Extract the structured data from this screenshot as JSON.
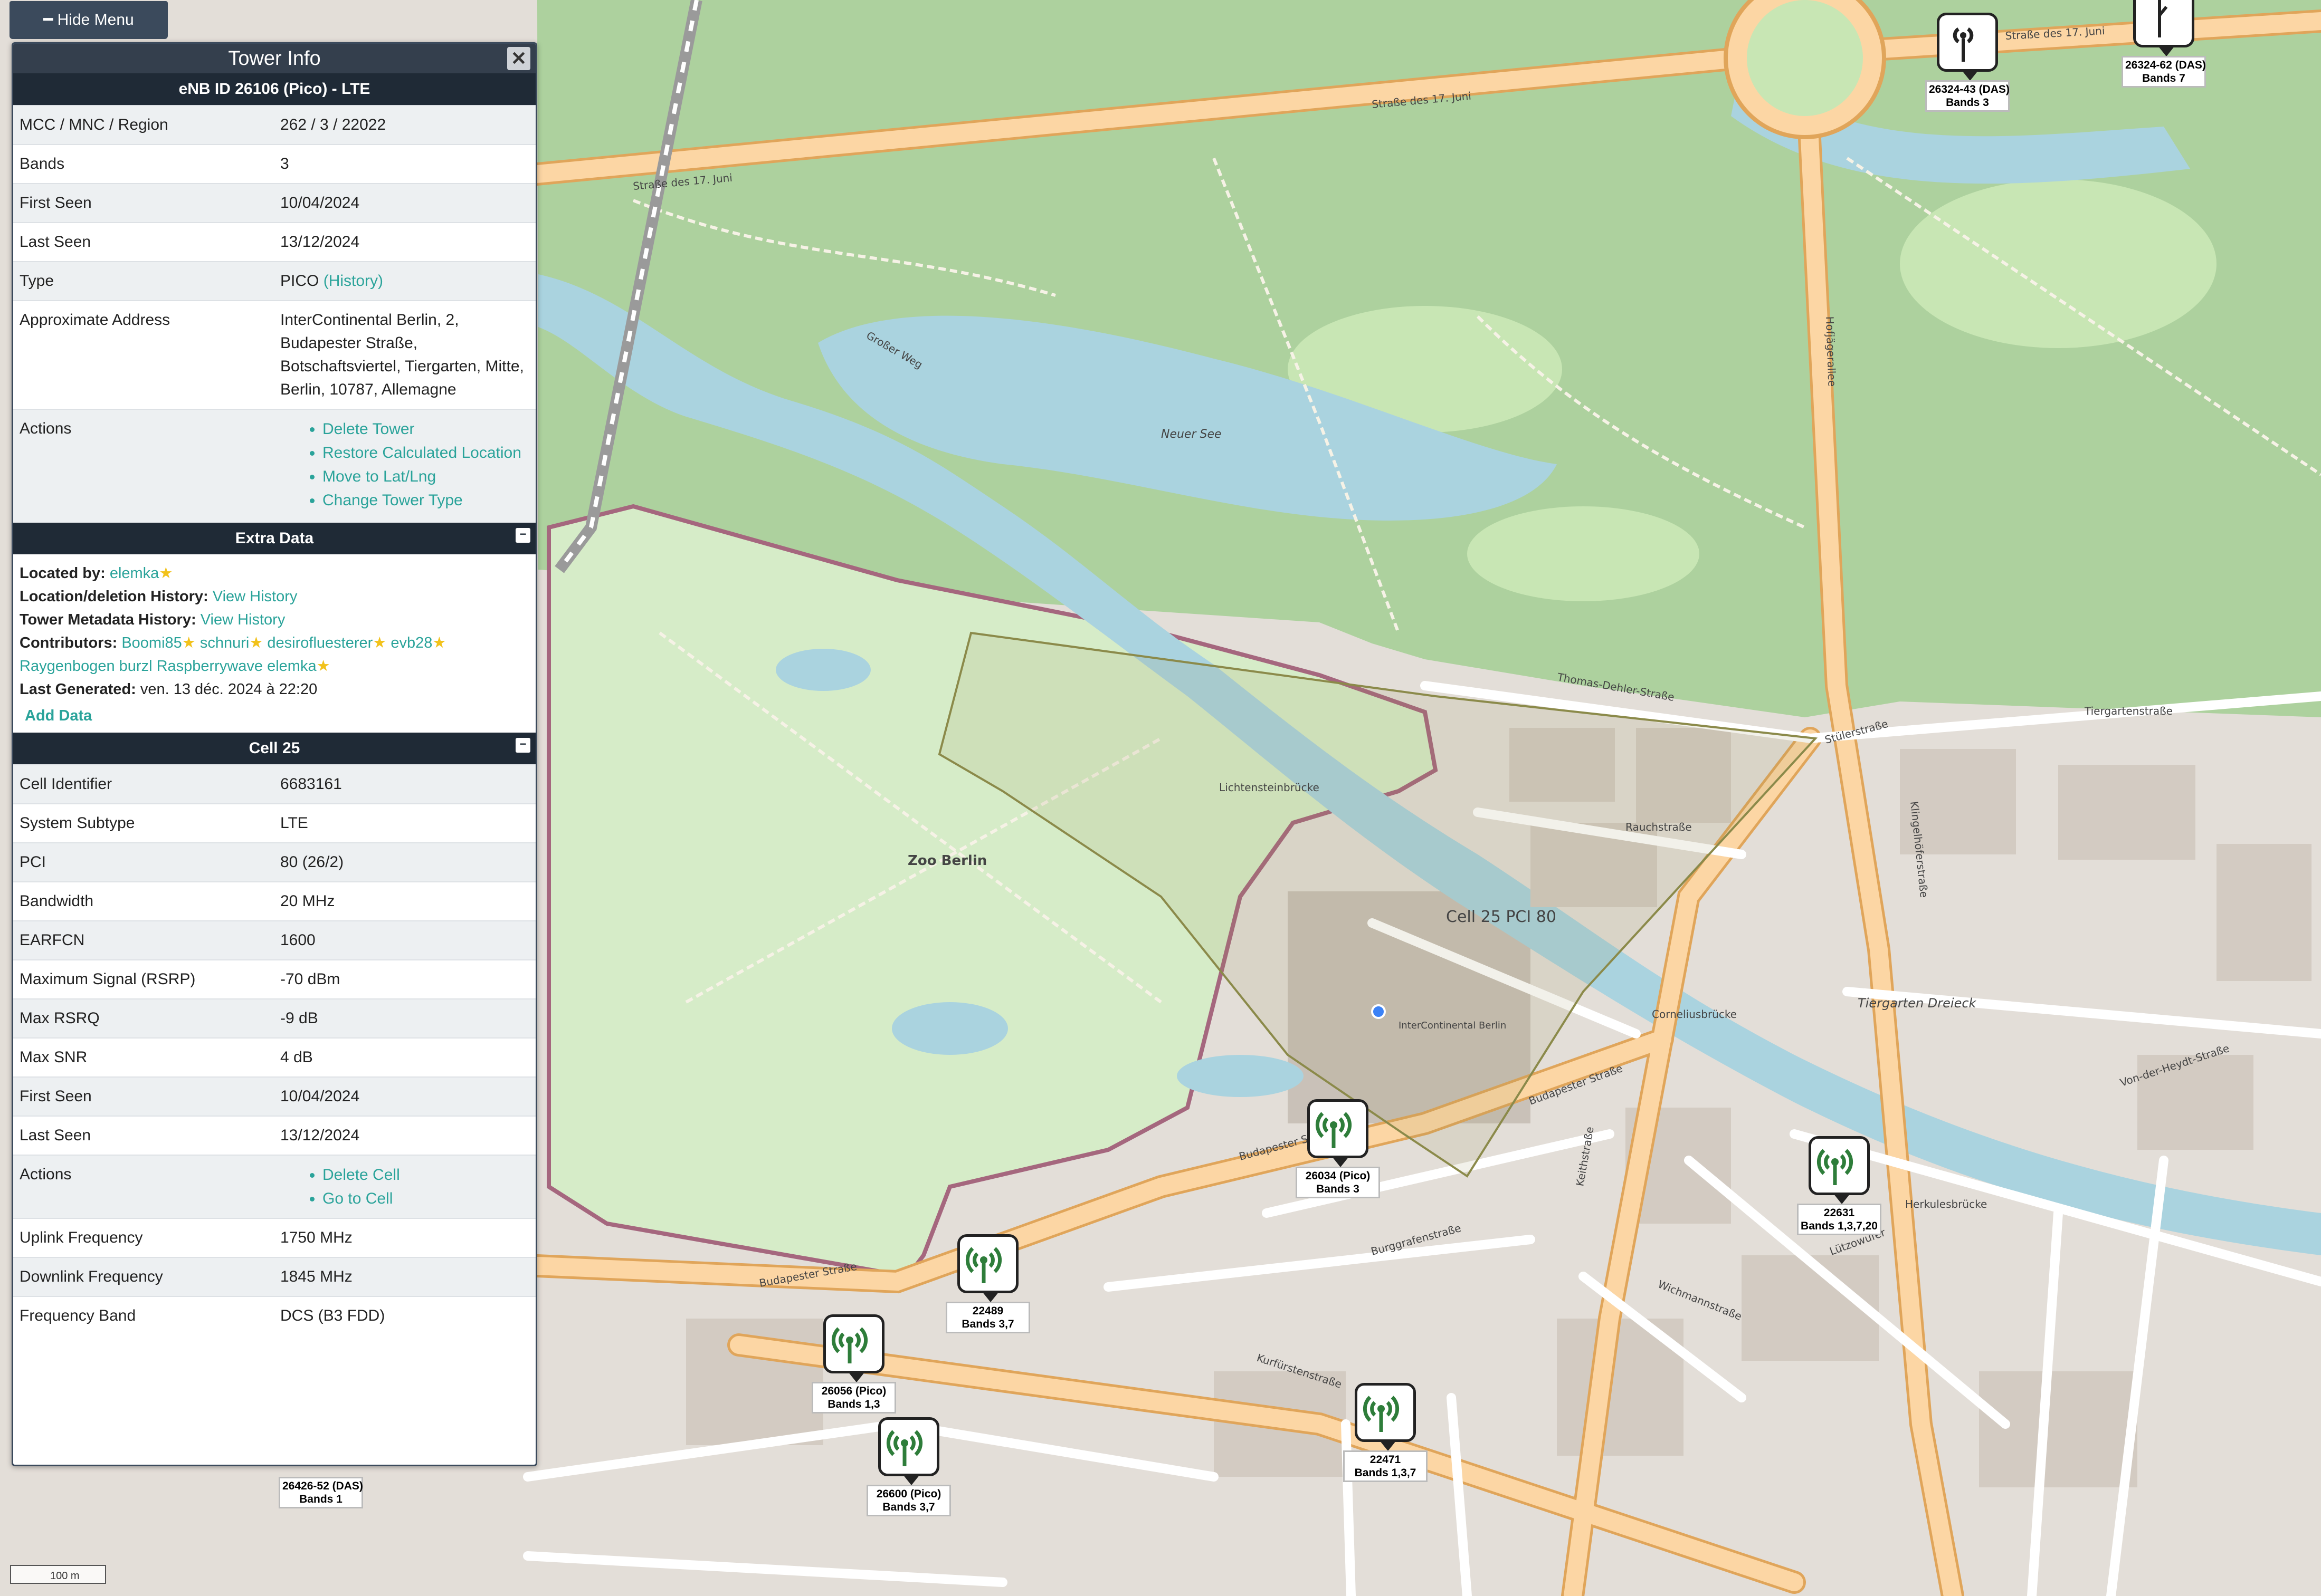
{
  "menu": {
    "hide_label": "━ Hide Menu"
  },
  "tower_info": {
    "title": "Tower Info",
    "close_label": "✕",
    "header": "eNB ID 26106 (Pico) - LTE",
    "rows": [
      {
        "key": "MCC / MNC / Region",
        "value": "262 / 3 / 22022"
      },
      {
        "key": "Bands",
        "value": "3"
      },
      {
        "key": "First Seen",
        "value": "10/04/2024"
      },
      {
        "key": "Last Seen",
        "value": "13/12/2024"
      },
      {
        "key": "Type",
        "value": "PICO",
        "link": "(History)"
      },
      {
        "key": "Approximate Address",
        "value": "InterContinental Berlin, 2, Budapester Straße, Botschaftsviertel, Tiergarten, Mitte, Berlin, 10787, Allemagne"
      }
    ],
    "actions_label": "Actions",
    "actions": [
      "Delete Tower",
      "Restore Calculated Location",
      "Move to Lat/Lng",
      "Change Tower Type"
    ]
  },
  "extra_data": {
    "title": "Extra Data",
    "collapse_label": "−",
    "located_by_label": "Located by:",
    "located_by": "elemka",
    "location_history_label": "Location/deletion History:",
    "location_history_link": "View History",
    "metadata_history_label": "Tower Metadata History:",
    "metadata_history_link": "View History",
    "contributors_label": "Contributors:",
    "contributors": [
      "Boomi85",
      "schnuri",
      "desirofluesterer",
      "evb28",
      "Raygenbogen burzl Raspberrywave elemka"
    ],
    "last_generated_label": "Last Generated:",
    "last_generated": "ven. 13 déc. 2024 à 22:20",
    "add_data": "Add Data"
  },
  "cell": {
    "title": "Cell 25",
    "collapse_label": "−",
    "rows": [
      {
        "key": "Cell Identifier",
        "value": "6683161"
      },
      {
        "key": "System Subtype",
        "value": "LTE"
      },
      {
        "key": "PCI",
        "value": "80 (26/2)"
      },
      {
        "key": "Bandwidth",
        "value": "20 MHz"
      },
      {
        "key": "EARFCN",
        "value": "1600"
      },
      {
        "key": "Maximum Signal (RSRP)",
        "value": "-70 dBm"
      },
      {
        "key": "Max RSRQ",
        "value": "-9 dB"
      },
      {
        "key": "Max SNR",
        "value": "4 dB"
      },
      {
        "key": "First Seen",
        "value": "10/04/2024"
      },
      {
        "key": "Last Seen",
        "value": "13/12/2024"
      }
    ],
    "actions_label": "Actions",
    "actions": [
      "Delete Cell",
      "Go to Cell"
    ],
    "rows2": [
      {
        "key": "Uplink Frequency",
        "value": "1750 MHz"
      },
      {
        "key": "Downlink Frequency",
        "value": "1845 MHz"
      },
      {
        "key": "Frequency Band",
        "value": "DCS (B3 FDD)"
      }
    ]
  },
  "map": {
    "sector_label": "Cell 25 PCI 80",
    "scale": "100 m",
    "labels": {
      "zoo": "Zoo Berlin",
      "neuer_see": "Neuer See",
      "strasse17": "Straße des 17. Juni",
      "budapester": "Budapester Straße",
      "kurfuersten": "Kurfürstenstraße",
      "tiergarten": "Tiergartenstraße",
      "stueler": "Stülerstraße",
      "rauch": "Rauchstraße",
      "corneliusbruecke": "Corneliusbrücke",
      "lichtenstein": "Lichtensteinbrücke",
      "lutzow": "Lützowufer",
      "hofjaeger": "Hofjägerallee",
      "klingel": "Klingelhöferstraße",
      "intercont": "InterContinental Berlin",
      "tiergarten_dreieck": "Tiergarten Dreieck",
      "grosser_weg": "Großer Weg",
      "thomas_dehler": "Thomas-Dehler-Straße",
      "von_der_heydt": "Von-der-Heydt-Straße",
      "herkules": "Herkulesbrücke",
      "keith": "Keithstraße",
      "wichmann": "Wichmannstraße",
      "burggrafen": "Burggrafenstraße"
    },
    "towers": [
      {
        "id": "26034 (Pico)",
        "bands": "Bands 3"
      },
      {
        "id": "22489",
        "bands": "Bands 3,7"
      },
      {
        "id": "26056 (Pico)",
        "bands": "Bands 1,3"
      },
      {
        "id": "26600 (Pico)",
        "bands": "Bands 3,7"
      },
      {
        "id": "22471",
        "bands": "Bands 1,3,7"
      },
      {
        "id": "22631",
        "bands": "Bands 1,3,7,20"
      },
      {
        "id": "26426-52 (DAS)",
        "bands": "Bands 1"
      },
      {
        "id": "26324-43 (DAS)",
        "bands": "Bands 3"
      },
      {
        "id": "26324-62 (DAS)",
        "bands": "Bands 7"
      }
    ],
    "colors": {
      "park": "#add19e",
      "water": "#aad3df",
      "zoo": "#d6ecc8",
      "road_major": "#fcd6a4",
      "road_casing": "#e8a85c",
      "urban": "#e0dcd6",
      "building": "#d0c7be",
      "signal": "#2e7d3a"
    }
  }
}
